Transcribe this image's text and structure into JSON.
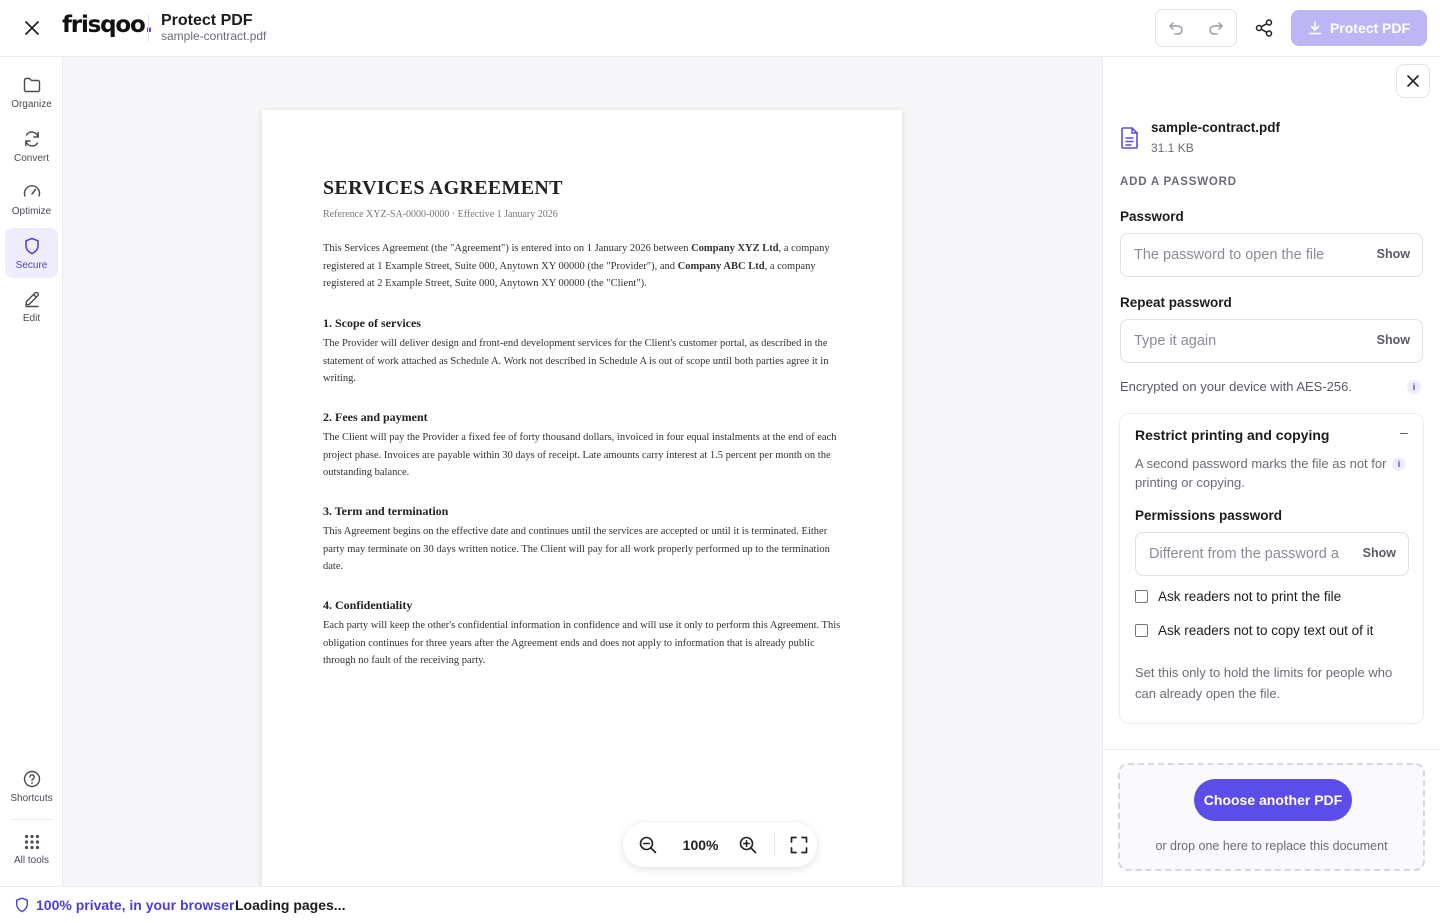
{
  "header": {
    "logo": "frisqoo",
    "title": "Protect PDF",
    "filename": "sample-contract.pdf",
    "protect_label": "Protect PDF"
  },
  "sidebar": {
    "items": [
      {
        "label": "Organize",
        "icon": "folder-icon"
      },
      {
        "label": "Convert",
        "icon": "refresh-icon"
      },
      {
        "label": "Optimize",
        "icon": "gauge-icon"
      },
      {
        "label": "Secure",
        "icon": "shield-icon",
        "active": true
      },
      {
        "label": "Edit",
        "icon": "pen-icon"
      }
    ],
    "bottom": [
      {
        "label": "Shortcuts",
        "icon": "help-icon"
      },
      {
        "label": "All tools",
        "icon": "grid-icon"
      }
    ]
  },
  "document": {
    "title": "SERVICES AGREEMENT",
    "reference": "Reference XYZ-SA-0000-0000 · Effective 1 January 2026",
    "intro": {
      "p1": "This Services Agreement (the \"Agreement\") is entered into on 1 January 2026 between ",
      "b1": "Company XYZ Ltd",
      "p2": ", a company registered at 1 Example Street, Suite 000, Anytown XY 00000 (the \"Provider\"), and ",
      "b2": "Company ABC Ltd",
      "p3": ", a company registered at 2 Example Street, Suite 000, Anytown XY 00000 (the \"Client\")."
    },
    "sections": [
      {
        "heading": "1. Scope of services",
        "body": "The Provider will deliver design and front-end development services for the Client's customer portal, as described in the statement of work attached as Schedule A. Work not described in Schedule A is out of scope until both parties agree it in writing."
      },
      {
        "heading": "2. Fees and payment",
        "body": "The Client will pay the Provider a fixed fee of forty thousand dollars, invoiced in four equal instalments at the end of each project phase. Invoices are payable within 30 days of receipt. Late amounts carry interest at 1.5 percent per month on the outstanding balance."
      },
      {
        "heading": "3. Term and termination",
        "body": "This Agreement begins on the effective date and continues until the services are accepted or until it is terminated. Either party may terminate on 30 days written notice. The Client will pay for all work properly performed up to the termination date."
      },
      {
        "heading": "4. Confidentiality",
        "body": "Each party will keep the other's confidential information in confidence and will use it only to perform this Agreement. This obligation continues for three years after the Agreement ends and does not apply to information that is already public through no fault of the receiving party."
      }
    ]
  },
  "zoom": {
    "value": "100%"
  },
  "panel": {
    "file_name": "sample-contract.pdf",
    "file_size": "31.1 KB",
    "section_heading": "ADD A PASSWORD",
    "password_label": "Password",
    "password_placeholder": "The password to open the file",
    "repeat_label": "Repeat password",
    "repeat_placeholder": "Type it again",
    "show_label": "Show",
    "encryption_note": "Encrypted on your device with AES-256.",
    "info_glyph": "i",
    "restrict": {
      "title": "Restrict printing and copying",
      "toggle": "–",
      "description": "A second password marks the file as not for printing or copying.",
      "perm_label": "Permissions password",
      "perm_placeholder": "Different from the password a",
      "checkbox_print": "Ask readers not to print the file",
      "checkbox_copy": "Ask readers not to copy text out of it",
      "footnote": "Set this only to hold the limits for people who can already open the file."
    },
    "choose_label": "Choose another PDF",
    "drop_text": "or drop one here to replace this document"
  },
  "status": {
    "privacy": "100% private, in your browser",
    "loading": "Loading pages..."
  },
  "colors": {
    "accent": "#5b4ee8",
    "accent_disabled": "#bcb6f4",
    "active_bg": "#efedfc"
  }
}
